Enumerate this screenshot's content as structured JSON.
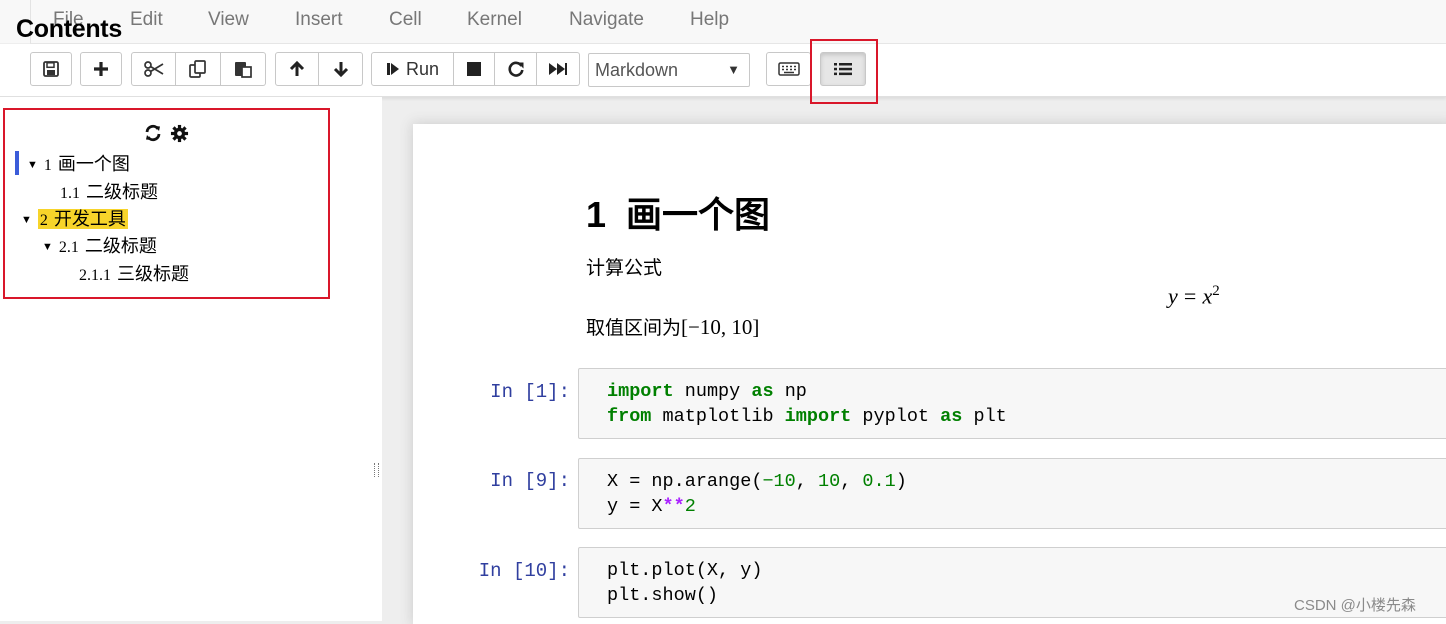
{
  "menubar": {
    "items": [
      "File",
      "Edit",
      "View",
      "Insert",
      "Cell",
      "Kernel",
      "Navigate",
      "Help"
    ]
  },
  "toolbar": {
    "run_label": "Run",
    "cell_type": "Markdown",
    "icons": [
      "save-icon",
      "plus-icon",
      "cut-icon",
      "copy-icon",
      "paste-icon",
      "arrow-up-icon",
      "arrow-down-icon",
      "step-forward-icon",
      "stop-icon",
      "restart-icon",
      "fast-forward-icon",
      "keyboard-icon",
      "list-icon"
    ]
  },
  "toc": {
    "title": "Contents",
    "items": [
      {
        "num": "1",
        "label": "画一个图"
      },
      {
        "num": "1.1",
        "label": "二级标题"
      },
      {
        "num": "2",
        "label": "开发工具"
      },
      {
        "num": "2.1",
        "label": "二级标题"
      },
      {
        "num": "2.1.1",
        "label": "三级标题"
      }
    ]
  },
  "notebook": {
    "heading_num": "1",
    "heading_text": "画一个图",
    "para1": "计算公式",
    "formula": {
      "lhs": "y",
      "eq": "=",
      "base": "x",
      "exp": "2"
    },
    "para2_text": "取值区间为",
    "para2_range": "[−10, 10]",
    "cells": [
      {
        "prompt": "In  [1]:",
        "lines": [
          [
            "import",
            "numpy",
            "as",
            "np"
          ],
          [
            "from",
            "matplotlib",
            "import",
            "pyplot",
            "as",
            "plt"
          ]
        ]
      },
      {
        "prompt": "In  [9]:",
        "lines": [
          "X = np.arange(−10, 10, 0.1)",
          "y = X**2"
        ]
      },
      {
        "prompt": "In  [10]:",
        "lines": [
          "plt.plot(X, y)",
          "plt.show()"
        ]
      }
    ]
  },
  "watermark": "CSDN @小楼先森",
  "colors": {
    "highlight_red": "#d9172a",
    "toc_highlight": "#f7d42a",
    "toc_bar": "#3b5cd9",
    "prompt_blue": "#303f9f",
    "keyword_green": "#008000",
    "operator_purple": "#aa22ff"
  }
}
